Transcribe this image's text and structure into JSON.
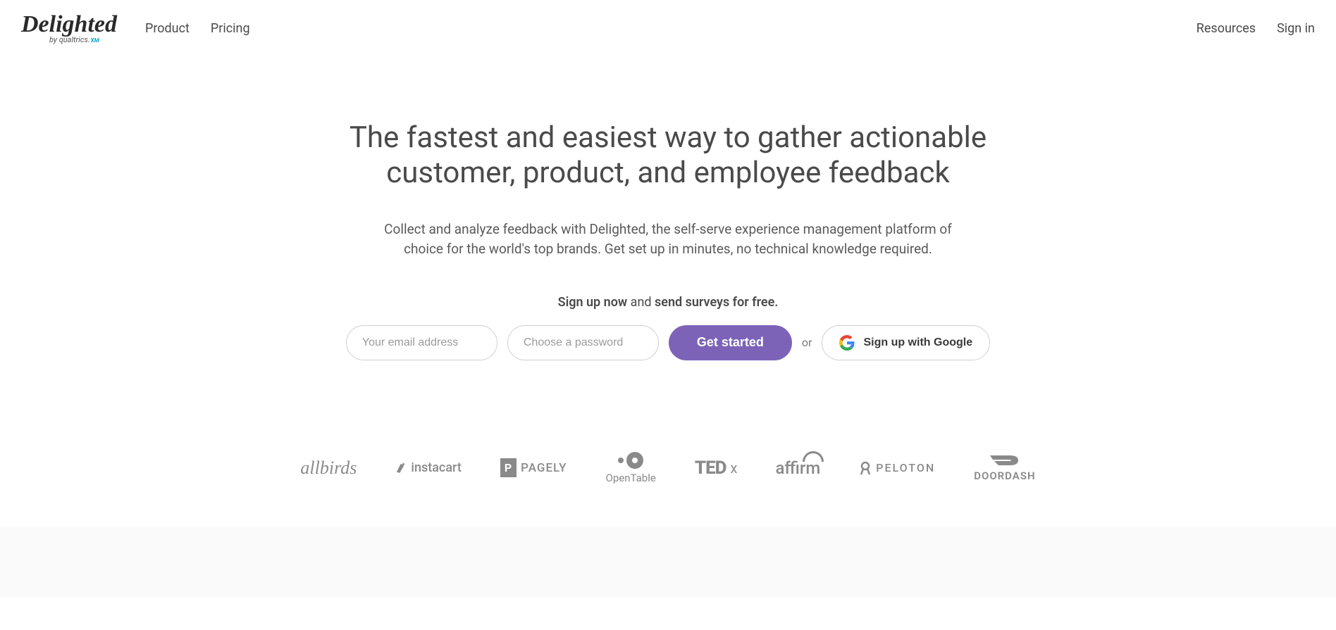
{
  "logo": {
    "main": "Delighted",
    "sub_prefix": "by ",
    "sub_brand": "qualtrics.",
    "sub_badge": "XM"
  },
  "nav": {
    "left": [
      "Product",
      "Pricing"
    ],
    "right": [
      "Resources",
      "Sign in"
    ]
  },
  "hero": {
    "title": "The fastest and easiest way to gather actionable customer, product, and employee feedback",
    "subtitle": "Collect and analyze feedback with Delighted, the self-serve experience management platform of choice for the world's top brands. Get set up in minutes, no technical knowledge required.",
    "prompt_bold1": "Sign up now",
    "prompt_mid": " and ",
    "prompt_bold2": "send surveys for free."
  },
  "form": {
    "email_placeholder": "Your email address",
    "password_placeholder": "Choose a password",
    "submit_label": "Get started",
    "or_label": "or",
    "google_label": "Sign up with Google"
  },
  "brands": {
    "allbirds": "allbirds",
    "instacart": "instacart",
    "pagely": "PAGELY",
    "opentable": "OpenTable",
    "tedx_main": "TED",
    "tedx_x": "x",
    "affirm": "affirm",
    "peloton": "PELOTON",
    "doordash": "DOORDASH"
  },
  "colors": {
    "primary": "#7c63b8",
    "text": "#4a4a4a",
    "muted": "#8a8a8a"
  }
}
